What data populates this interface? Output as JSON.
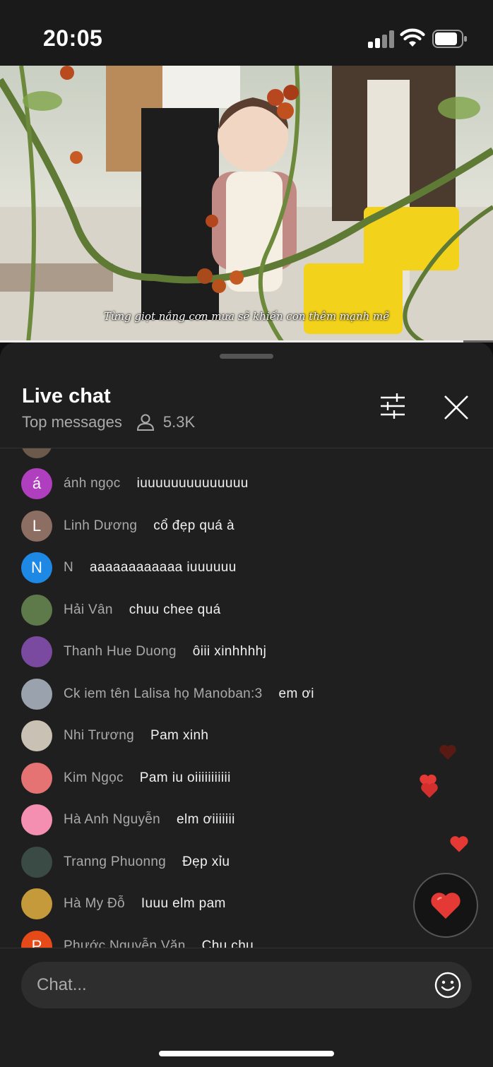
{
  "status_bar": {
    "time": "20:05"
  },
  "video": {
    "caption": "Từng giọt nắng cơn mưa sẽ khiến con thêm mạnh mẽ",
    "progress_fraction": 0.94
  },
  "live_chat": {
    "title": "Live chat",
    "mode": "Top messages",
    "viewer_count": "5.3K",
    "messages": [
      {
        "author": "ánh ngọc",
        "text": "iuuuuuuuuuuuuuu",
        "avatar_letter": "á",
        "avatar_color": "#b03fbf"
      },
      {
        "author": "Linh Dương",
        "text": "cổ đẹp quá à",
        "avatar_letter": "L",
        "avatar_color": "#8d6e63"
      },
      {
        "author": "N",
        "text": "aaaaaaaaaaaa iuuuuuu",
        "avatar_letter": "N",
        "avatar_color": "#1e88e5"
      },
      {
        "author": "Hải Vân",
        "text": "chuu chee quá",
        "avatar_letter": "",
        "avatar_color": "#5f7a4a"
      },
      {
        "author": "Thanh Hue Duong",
        "text": "ôiii xinhhhhj",
        "avatar_letter": "",
        "avatar_color": "#7a4aa0"
      },
      {
        "author": "Ck iem tên Lalisa họ Manoban:3",
        "text": "em ơi",
        "avatar_letter": "",
        "avatar_color": "#9aa3ad"
      },
      {
        "author": "Nhi Trương",
        "text": "Pam xinh",
        "avatar_letter": "",
        "avatar_color": "#c9c2b4"
      },
      {
        "author": "Kim Ngọc",
        "text": "Pam iu oiiiiiiiiiii",
        "avatar_letter": "",
        "avatar_color": "#e57373"
      },
      {
        "author": "Hà Anh Nguyễn",
        "text": "elm ơiiiiiii",
        "avatar_letter": "",
        "avatar_color": "#f48fb1"
      },
      {
        "author": "Tranng Phuonng",
        "text": "Đẹp xỉu",
        "avatar_letter": "",
        "avatar_color": "#3a4a44"
      },
      {
        "author": "Hà My Đỗ",
        "text": "Iuuu elm pam",
        "avatar_letter": "",
        "avatar_color": "#c49a3a"
      },
      {
        "author": "Phước Nguyễn Văn",
        "text": "Chu chu",
        "avatar_letter": "P",
        "avatar_color": "#e64a19"
      }
    ]
  },
  "chat_input": {
    "placeholder": "Chat..."
  },
  "icons": {
    "signal": "cellular-signal-icon",
    "wifi": "wifi-icon",
    "battery": "battery-icon",
    "viewers": "person-icon",
    "filter": "sliders-icon",
    "close": "close-icon",
    "emoji": "smiley-icon",
    "heart": "heart-icon"
  },
  "colors": {
    "panel_bg": "#1f1f1f",
    "heart_red": "#e53935"
  }
}
